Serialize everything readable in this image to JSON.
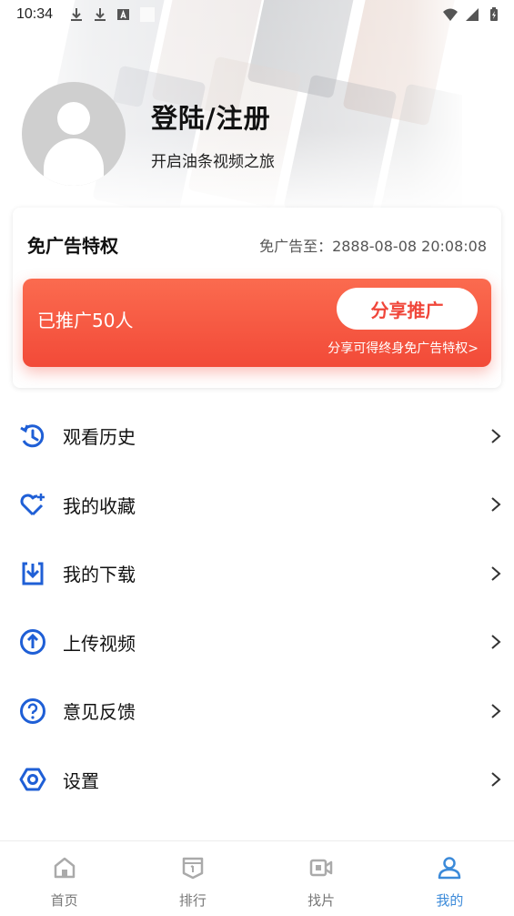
{
  "status_bar": {
    "time": "10:34",
    "left_icons": [
      "download-icon",
      "download-icon",
      "a-icon",
      "blank-icon"
    ],
    "right_icons": [
      "wifi-icon",
      "signal-icon",
      "battery-icon"
    ]
  },
  "profile": {
    "title": "登陆/注册",
    "subtitle": "开启油条视频之旅"
  },
  "ad_card": {
    "title": "免广告特权",
    "expire_label": "免广告至：2888-08-08 20:08:08",
    "promo_count": "已推广50人",
    "share_button": "分享推广",
    "share_note": "分享可得终身免广告特权>"
  },
  "menu": [
    {
      "label": "观看历史",
      "icon": "history-icon"
    },
    {
      "label": "我的收藏",
      "icon": "heart-plus-icon"
    },
    {
      "label": "我的下载",
      "icon": "download-box-icon"
    },
    {
      "label": "上传视频",
      "icon": "upload-icon"
    },
    {
      "label": "意见反馈",
      "icon": "question-icon"
    },
    {
      "label": "设置",
      "icon": "settings-icon"
    }
  ],
  "bottom_nav": [
    {
      "label": "首页",
      "icon": "home-icon",
      "active": false
    },
    {
      "label": "排行",
      "icon": "ranking-icon",
      "active": false
    },
    {
      "label": "找片",
      "icon": "video-icon",
      "active": false
    },
    {
      "label": "我的",
      "icon": "user-icon",
      "active": true
    }
  ],
  "colors": {
    "accent_blue": "#1f5fd6",
    "nav_active": "#3b8ad9",
    "promo_red": "#f24a38"
  }
}
